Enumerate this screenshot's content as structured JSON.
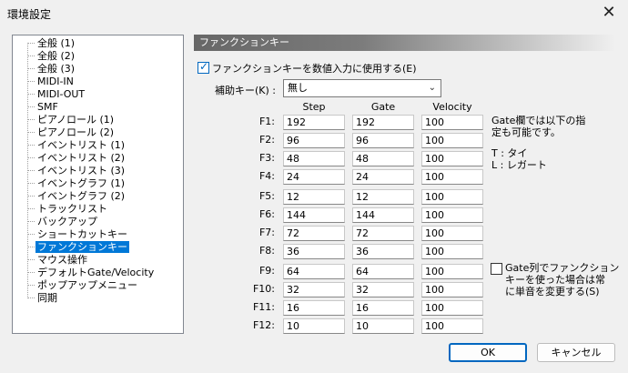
{
  "window": {
    "title": "環境設定",
    "close_glyph": "✕"
  },
  "tree": {
    "items": [
      {
        "label": "全般 (1)"
      },
      {
        "label": "全般 (2)"
      },
      {
        "label": "全般 (3)"
      },
      {
        "label": "MIDI-IN"
      },
      {
        "label": "MIDI-OUT"
      },
      {
        "label": "SMF"
      },
      {
        "label": "ピアノロール (1)"
      },
      {
        "label": "ピアノロール (2)"
      },
      {
        "label": "イベントリスト (1)"
      },
      {
        "label": "イベントリスト (2)"
      },
      {
        "label": "イベントリスト (3)"
      },
      {
        "label": "イベントグラフ (1)"
      },
      {
        "label": "イベントグラフ (2)"
      },
      {
        "label": "トラックリスト"
      },
      {
        "label": "バックアップ"
      },
      {
        "label": "ショートカットキー"
      },
      {
        "label": "ファンクションキー",
        "selected": true
      },
      {
        "label": "マウス操作"
      },
      {
        "label": "デフォルトGate/Velocity"
      },
      {
        "label": "ポップアップメニュー"
      },
      {
        "label": "同期"
      }
    ]
  },
  "panel": {
    "title": "ファンクションキー",
    "use_fkey_checkbox": {
      "label": "ファンクションキーを数値入力に使用する(E)",
      "checked": true
    },
    "modifier": {
      "label": "補助キー(K) :",
      "value": "無し"
    },
    "columns": {
      "step": "Step",
      "gate": "Gate",
      "velocity": "Velocity"
    },
    "rows": [
      {
        "key": "F1:",
        "step": "192",
        "gate": "192",
        "velocity": "100"
      },
      {
        "key": "F2:",
        "step": "96",
        "gate": "96",
        "velocity": "100"
      },
      {
        "key": "F3:",
        "step": "48",
        "gate": "48",
        "velocity": "100"
      },
      {
        "key": "F4:",
        "step": "24",
        "gate": "24",
        "velocity": "100"
      },
      {
        "key": "F5:",
        "step": "12",
        "gate": "12",
        "velocity": "100"
      },
      {
        "key": "F6:",
        "step": "144",
        "gate": "144",
        "velocity": "100"
      },
      {
        "key": "F7:",
        "step": "72",
        "gate": "72",
        "velocity": "100"
      },
      {
        "key": "F8:",
        "step": "36",
        "gate": "36",
        "velocity": "100"
      },
      {
        "key": "F9:",
        "step": "64",
        "gate": "64",
        "velocity": "100"
      },
      {
        "key": "F10:",
        "step": "32",
        "gate": "32",
        "velocity": "100"
      },
      {
        "key": "F11:",
        "step": "16",
        "gate": "16",
        "velocity": "100"
      },
      {
        "key": "F12:",
        "step": "10",
        "gate": "10",
        "velocity": "100"
      }
    ],
    "gate_note_line1": "Gate欄では以下の指",
    "gate_note_line2": "定も可能です。",
    "tie_note": "T : タイ",
    "legato_note": "L : レガート",
    "change_gate_checkbox": {
      "line1": "Gate列でファンクション",
      "line2": "キーを使った場合は常",
      "line3": "に単音を変更する(S)",
      "checked": false
    }
  },
  "buttons": {
    "ok": "OK",
    "cancel": "キャンセル"
  }
}
